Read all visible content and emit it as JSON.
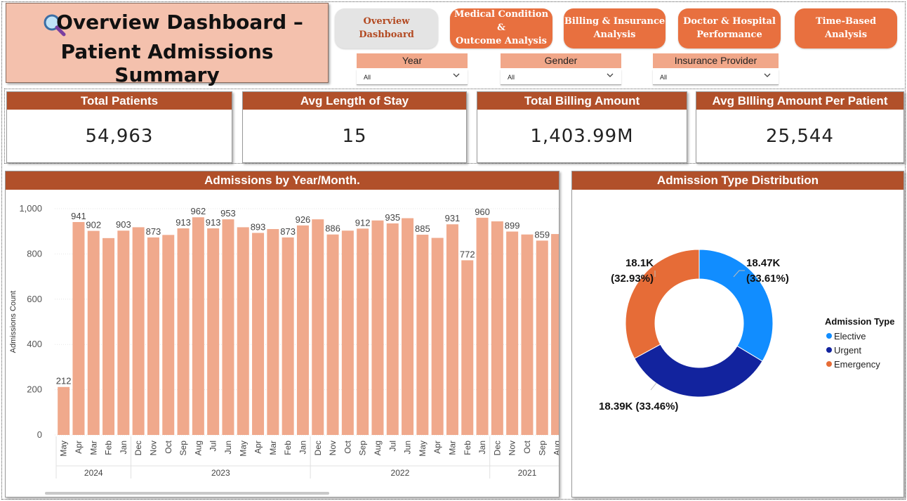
{
  "header": {
    "title_line1": "Overview Dashboard –",
    "title_line2": "Patient Admissions Summary",
    "title_icon": "magnifier-icon"
  },
  "nav": [
    {
      "label": "Overview Dashboard",
      "active": true
    },
    {
      "label_line1": "Medical Condition &",
      "label_line2": "Outcome Analysis"
    },
    {
      "label_line1": "Billing & Insurance",
      "label_line2": "Analysis"
    },
    {
      "label_line1": "Doctor & Hospital",
      "label_line2": "Performance"
    },
    {
      "label": "Time-Based Analysis"
    }
  ],
  "slicers": [
    {
      "label": "Year",
      "value": "All",
      "icon": "chevron-down-icon"
    },
    {
      "label": "Gender",
      "value": "All",
      "icon": "chevron-down-icon"
    },
    {
      "label": "Insurance Provider",
      "value": "All",
      "icon": "chevron-down-icon"
    }
  ],
  "kpis": [
    {
      "label": "Total Patients",
      "value": "54,963"
    },
    {
      "label": "Avg Length of Stay",
      "value": "15"
    },
    {
      "label": "Total Billing Amount",
      "value": "1,403.99M"
    },
    {
      "label": "Avg BIlling Amount Per Patient",
      "value": "25,544"
    }
  ],
  "colors": {
    "accent": "#b1502a",
    "nav": "#e8703f",
    "bar": "#f0a98c",
    "elective": "#118dff",
    "urgent": "#12239e",
    "emergency": "#e66c37"
  },
  "chart_data": [
    {
      "type": "bar",
      "title": "Admissions by Year/Month.",
      "ylabel": "Admissions Count",
      "ylim": [
        0,
        1000
      ],
      "yticks": [
        "0",
        "200",
        "400",
        "600",
        "800",
        "1,000"
      ],
      "grid": true,
      "categories": [
        "May",
        "Apr",
        "Mar",
        "Feb",
        "Jan",
        "Dec",
        "Nov",
        "Oct",
        "Sep",
        "Aug",
        "Jul",
        "Jun",
        "May",
        "Apr",
        "Mar",
        "Feb",
        "Jan",
        "Dec",
        "Nov",
        "Oct",
        "Sep",
        "Aug",
        "Jul",
        "Jun",
        "May",
        "Apr",
        "Mar",
        "Feb",
        "Jan",
        "Dec",
        "Nov",
        "Oct",
        "Sep",
        "Aug"
      ],
      "values": [
        212,
        941,
        902,
        870,
        903,
        918,
        873,
        884,
        913,
        962,
        913,
        953,
        918,
        893,
        910,
        873,
        926,
        953,
        886,
        903,
        912,
        948,
        935,
        958,
        885,
        871,
        931,
        772,
        960,
        944,
        899,
        886,
        859,
        888
      ],
      "value_labels": [
        "212",
        "941",
        "902",
        "",
        "903",
        "",
        "873",
        "",
        "913",
        "962",
        "913",
        "953",
        "",
        "893",
        "",
        "873",
        "926",
        "",
        "886",
        "",
        "912",
        "",
        "935",
        "",
        "885",
        "",
        "931",
        "772",
        "960",
        "",
        "899",
        "",
        "859",
        ""
      ],
      "year_groups": [
        {
          "label": "2024",
          "count": 5
        },
        {
          "label": "2023",
          "count": 12
        },
        {
          "label": "2022",
          "count": 12
        },
        {
          "label": "2021",
          "count": 5
        }
      ]
    },
    {
      "type": "pie",
      "title": "Admission Type Distribution",
      "legend_title": "Admission Type",
      "legend_position": "right",
      "slices": [
        {
          "name": "Elective",
          "value": 18470,
          "label_line1": "18.47K",
          "label_line2": "(33.61%)"
        },
        {
          "name": "Urgent",
          "value": 18390,
          "label_line1": "18.39K (33.46%)",
          "label_line2": ""
        },
        {
          "name": "Emergency",
          "value": 18100,
          "label_line1": "18.1K",
          "label_line2": "(32.93%)"
        }
      ]
    }
  ]
}
